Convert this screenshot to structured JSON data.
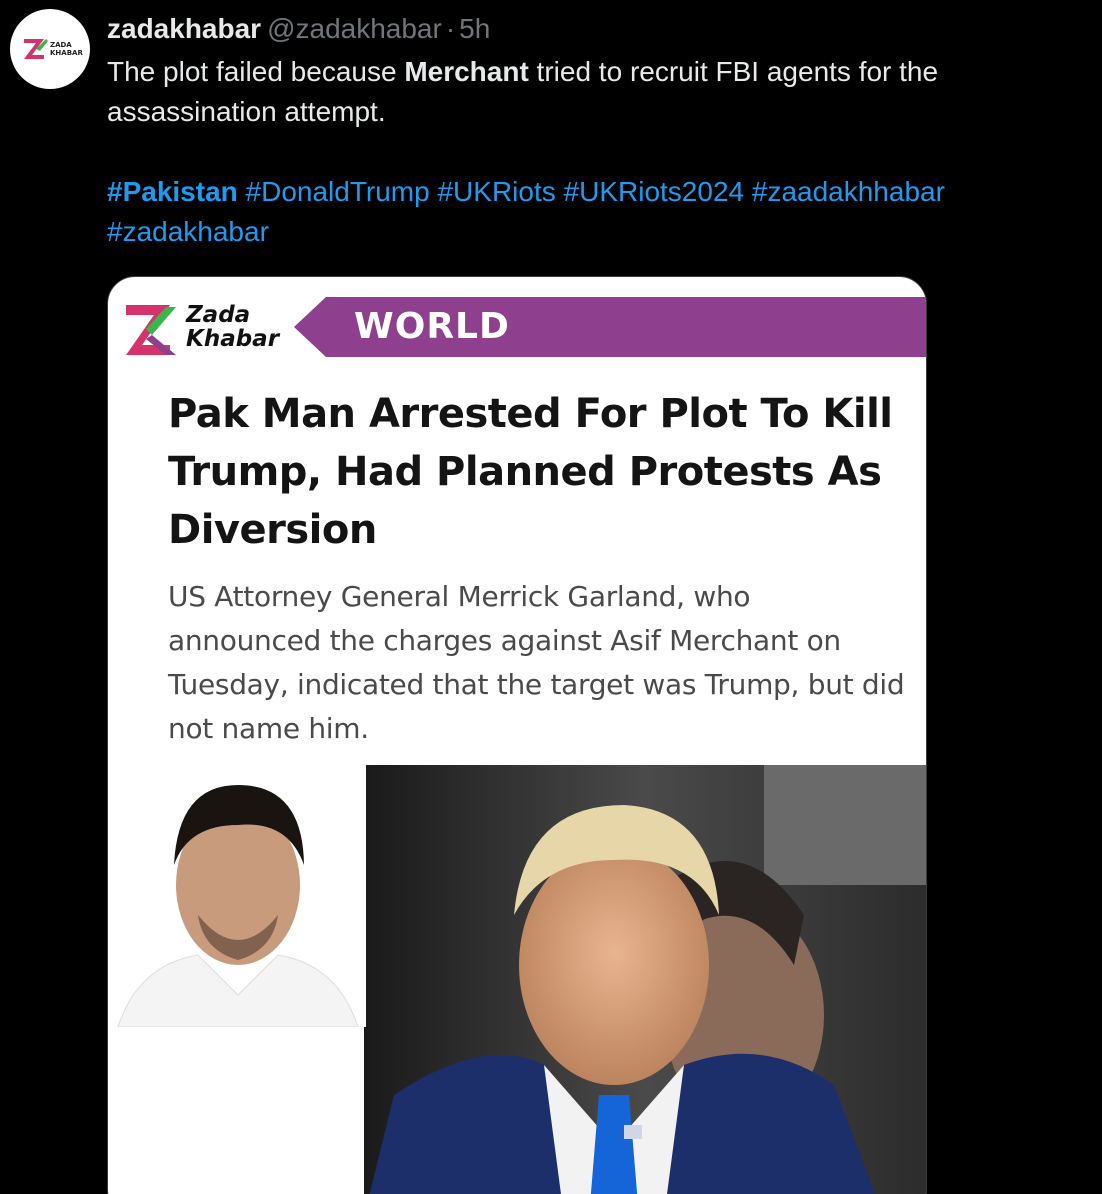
{
  "author": {
    "display_name": "zadakhabar",
    "handle": "@zadakhabar",
    "separator": "·",
    "time": "5h"
  },
  "avatar": {
    "logo_text_line1": "ZADA",
    "logo_text_line2": "KHABAR"
  },
  "tweet": {
    "text_before": "The plot failed because ",
    "text_bold": "Merchant",
    "text_after": " tried to recruit FBI agents for the assassination attempt.",
    "hashtags": [
      "#Pakistan",
      "#DonaldTrump",
      "#UKRiots",
      "#UKRiots2024",
      "#zaadakhhabar",
      "#zadakhabar"
    ]
  },
  "card": {
    "brand_line1": "Zada",
    "brand_line2": "Khabar",
    "section": "WORLD",
    "headline": "Pak Man Arrested For Plot To Kill Trump, Had Planned Protests As Diversion",
    "summary": "US Attorney General Merrick Garland, who announced the charges against Asif Merchant on Tuesday, indicated that the target was Trump, but did not name him."
  },
  "colors": {
    "background": "#000000",
    "link": "#1d9bf0",
    "banner": "#8e3f8e",
    "logo_pink": "#d6336c",
    "logo_green": "#3cb44b"
  }
}
